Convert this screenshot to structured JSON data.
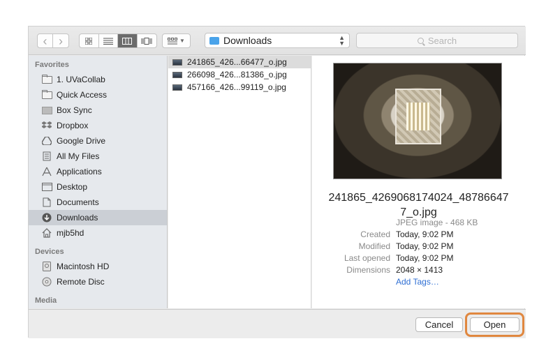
{
  "toolbar": {
    "nav_back": "‹",
    "nav_forward": "›",
    "location": "Downloads",
    "search_placeholder": "Search"
  },
  "sidebar": {
    "favorites_header": "Favorites",
    "favorites": [
      {
        "label": "1. UVaCollab",
        "icon": "folder-icon"
      },
      {
        "label": "Quick Access",
        "icon": "folder-icon"
      },
      {
        "label": "Box Sync",
        "icon": "box-icon"
      },
      {
        "label": "Dropbox",
        "icon": "dropbox-icon"
      },
      {
        "label": "Google Drive",
        "icon": "google-drive-icon"
      },
      {
        "label": "All My Files",
        "icon": "all-files-icon"
      },
      {
        "label": "Applications",
        "icon": "applications-icon"
      },
      {
        "label": "Desktop",
        "icon": "desktop-icon"
      },
      {
        "label": "Documents",
        "icon": "documents-icon"
      },
      {
        "label": "Downloads",
        "icon": "downloads-icon",
        "selected": true
      },
      {
        "label": "mjb5hd",
        "icon": "home-icon"
      }
    ],
    "devices_header": "Devices",
    "devices": [
      {
        "label": "Macintosh HD",
        "icon": "hard-drive-icon"
      },
      {
        "label": "Remote Disc",
        "icon": "disc-icon"
      }
    ],
    "media_header": "Media"
  },
  "files": [
    {
      "name": "241865_426...66477_o.jpg",
      "selected": true
    },
    {
      "name": "266098_426...81386_o.jpg",
      "selected": false
    },
    {
      "name": "457166_426...99119_o.jpg",
      "selected": false
    }
  ],
  "preview": {
    "filename": "241865_4269068174024_48786647 7_o.jpg",
    "type": "JPEG image - 468 KB",
    "created_label": "Created",
    "created": "Today, 9:02 PM",
    "modified_label": "Modified",
    "modified": "Today, 9:02 PM",
    "last_opened_label": "Last opened",
    "last_opened": "Today, 9:02 PM",
    "dimensions_label": "Dimensions",
    "dimensions": "2048 × 1413",
    "add_tags": "Add Tags…"
  },
  "buttons": {
    "cancel": "Cancel",
    "open": "Open"
  },
  "colors": {
    "highlight_ring": "#e0873f",
    "link": "#2f6fd4",
    "folder_accent": "#4aa3ea"
  }
}
